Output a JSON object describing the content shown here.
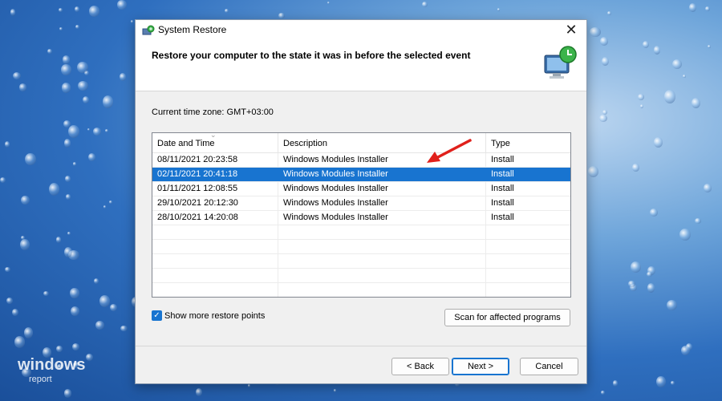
{
  "window": {
    "title": "System Restore",
    "heading": "Restore your computer to the state it was in before the selected event",
    "close_glyph": "✕"
  },
  "timezone_label": "Current time zone: GMT+03:00",
  "table": {
    "columns": [
      "Date and Time",
      "Description",
      "Type"
    ],
    "sort_indicator": "⌄",
    "rows": [
      {
        "date": "08/11/2021 20:23:58",
        "description": "Windows Modules Installer",
        "type": "Install"
      },
      {
        "date": "02/11/2021 20:41:18",
        "description": "Windows Modules Installer",
        "type": "Install"
      },
      {
        "date": "01/11/2021 12:08:55",
        "description": "Windows Modules Installer",
        "type": "Install"
      },
      {
        "date": "29/10/2021 20:12:30",
        "description": "Windows Modules Installer",
        "type": "Install"
      },
      {
        "date": "28/10/2021 14:20:08",
        "description": "Windows Modules Installer",
        "type": "Install"
      }
    ],
    "selected_row": 1
  },
  "show_more": {
    "label": "Show more restore points",
    "checked": true,
    "check_glyph": "✓"
  },
  "buttons": {
    "scan": "Scan for affected programs",
    "back": "< Back",
    "next": "Next >",
    "cancel": "Cancel"
  },
  "watermark": {
    "line1": "windows",
    "line2": "report"
  },
  "colors": {
    "selection": "#1874d0",
    "arrow": "#e0201b"
  }
}
